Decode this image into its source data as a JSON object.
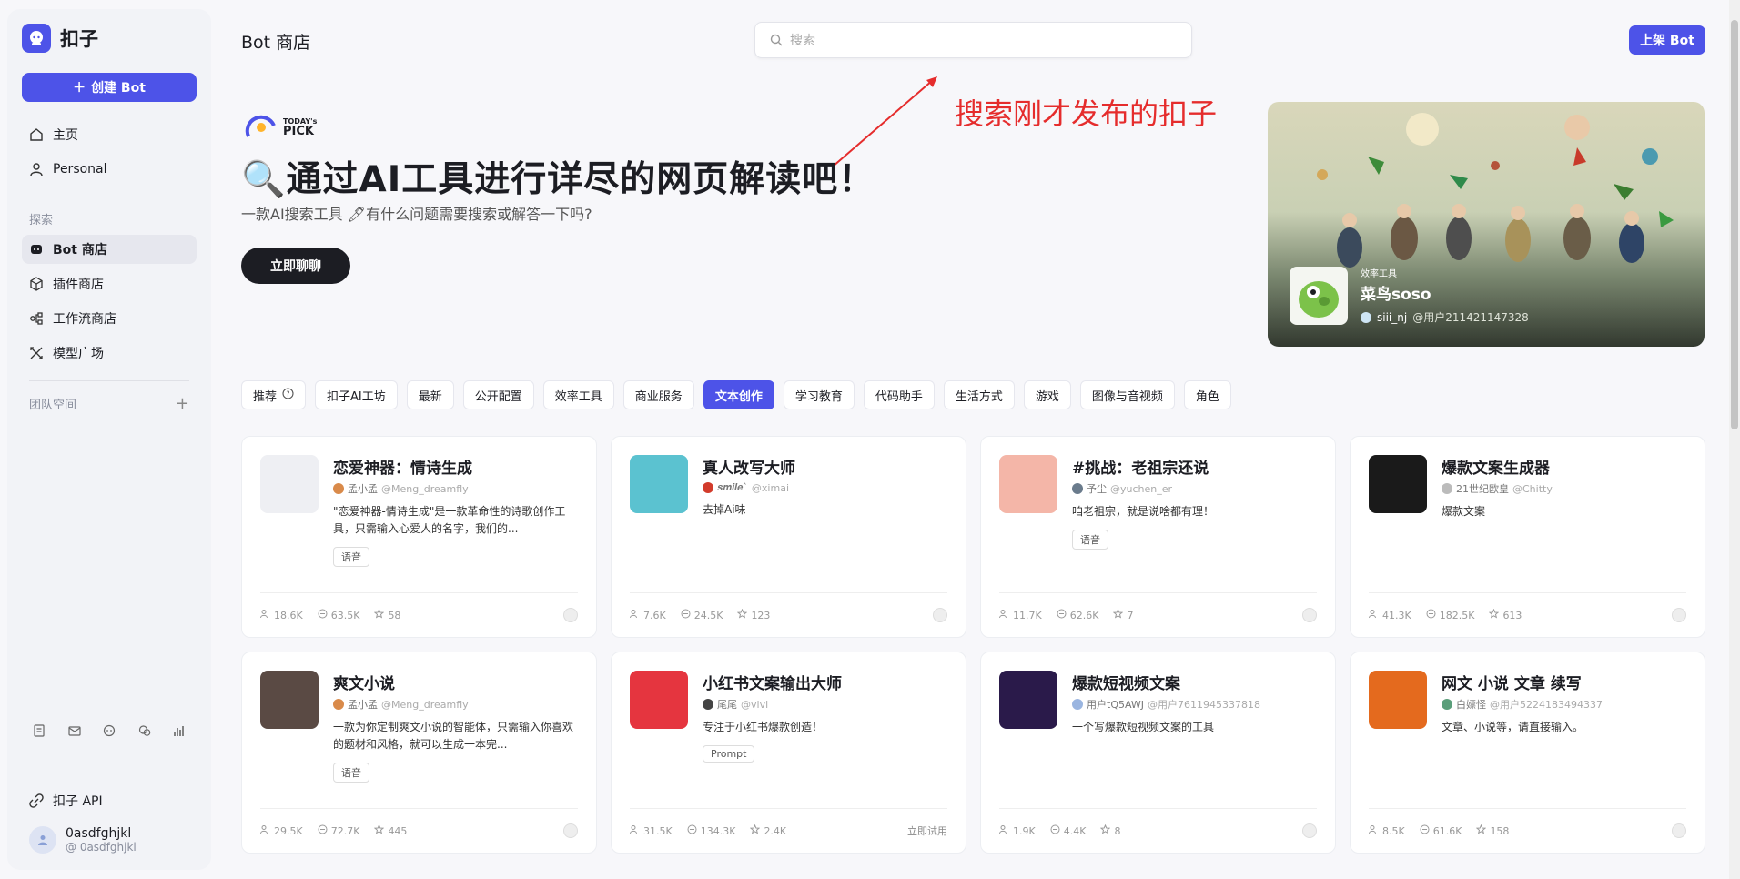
{
  "brand": {
    "name": "扣子"
  },
  "sidebar": {
    "create_label": "创建 Bot",
    "nav": [
      {
        "label": "主页",
        "icon": "home-icon"
      },
      {
        "label": "Personal",
        "icon": "person-icon"
      }
    ],
    "explore_label": "探索",
    "explore": [
      {
        "label": "Bot 商店",
        "icon": "bot-icon",
        "active": true
      },
      {
        "label": "插件商店",
        "icon": "cube-icon"
      },
      {
        "label": "工作流商店",
        "icon": "workflow-icon"
      },
      {
        "label": "模型广场",
        "icon": "model-icon"
      }
    ],
    "team_label": "团队空间",
    "api_label": "扣子 API",
    "user": {
      "name": "0asdfghjkl",
      "handle": "@ 0asdfghjkl"
    }
  },
  "header": {
    "title": "Bot 商店",
    "search_placeholder": "搜索",
    "upload_label": "上架 Bot"
  },
  "annotation": {
    "text": "搜索刚才发布的扣子",
    "color": "#e52c2c"
  },
  "hero": {
    "pick_top": "TODAY's",
    "pick_bottom": "PICK",
    "title": "🔍通过AI工具进行详尽的网页解读吧！",
    "subtitle": "一款AI搜索工具 🖊有什么问题需要搜索或解答一下吗?",
    "cta": "立即聊聊"
  },
  "banner": {
    "category": "效率工具",
    "name": "菜鸟soso",
    "author": "siii_nj",
    "handle": "@用户211421147328"
  },
  "tabs": [
    {
      "label": "推荐"
    },
    {
      "label": "扣子AI工坊"
    },
    {
      "label": "最新"
    },
    {
      "label": "公开配置"
    },
    {
      "label": "效率工具"
    },
    {
      "label": "商业服务"
    },
    {
      "label": "文本创作",
      "active": true
    },
    {
      "label": "学习教育"
    },
    {
      "label": "代码助手"
    },
    {
      "label": "生活方式"
    },
    {
      "label": "游戏"
    },
    {
      "label": "图像与音视频"
    },
    {
      "label": "角色"
    }
  ],
  "cards": [
    {
      "title": "恋爱神器：情诗生成",
      "author": "孟小孟",
      "handle": "@Meng_dreamfly",
      "desc": "\"恋爱神器-情诗生成\"是一款革命性的诗歌创作工具，只需输入心爱人的名字，我们的...",
      "tag": "语音",
      "users": "18.6K",
      "chats": "63.5K",
      "stars": "58",
      "img_color": "#eeeff3",
      "av_color": "#d98a4a"
    },
    {
      "title": "真人改写大师",
      "author": "𝒔𝒎𝒊𝒍𝒆`",
      "handle": "@ximai",
      "desc": "去掉Ai味",
      "tag": "",
      "users": "7.6K",
      "chats": "24.5K",
      "stars": "123",
      "img_color": "#5bc2d0",
      "av_color": "#d23b2b"
    },
    {
      "title": "#挑战：老祖宗还说",
      "author": "予尘",
      "handle": "@yuchen_er",
      "desc": "咱老祖宗，就是说啥都有理！",
      "tag": "语音",
      "users": "11.7K",
      "chats": "62.6K",
      "stars": "7",
      "img_color": "#f4b6a8",
      "av_color": "#6a7b8c"
    },
    {
      "title": "爆款文案生成器",
      "author": "21世纪欧皇",
      "handle": "@Chitty",
      "desc": "爆款文案",
      "tag": "",
      "users": "41.3K",
      "chats": "182.5K",
      "stars": "613",
      "img_color": "#1a1a1a",
      "av_color": "#bbbbbb"
    },
    {
      "title": "爽文小说",
      "author": "孟小孟",
      "handle": "@Meng_dreamfly",
      "desc": "一款为你定制爽文小说的智能体，只需输入你喜欢的题材和风格，就可以生成一本完...",
      "tag": "语音",
      "users": "29.5K",
      "chats": "72.7K",
      "stars": "445",
      "img_color": "#5a4a44",
      "av_color": "#d98a4a"
    },
    {
      "title": "小红书文案输出大师",
      "author": "尾尾",
      "handle": "@vivi",
      "desc": "专注于小红书爆款创造！",
      "tag": "Prompt",
      "users": "31.5K",
      "chats": "134.3K",
      "stars": "2.4K",
      "img_color": "#e5353f",
      "av_color": "#444444",
      "try": "立即试用"
    },
    {
      "title": "爆款短视频文案",
      "author": "用户tQ5AWJ",
      "handle": "@用户7611945337818",
      "desc": "一个写爆款短视频文案的工具",
      "tag": "",
      "users": "1.9K",
      "chats": "4.4K",
      "stars": "8",
      "img_color": "#2a1a4a",
      "av_color": "#9ab5e0"
    },
    {
      "title": "网文 小说 文章 续写",
      "author": "白嫖怪",
      "handle": "@用户5224183494337",
      "desc": "文章、小说等，请直接输入。",
      "tag": "",
      "users": "8.5K",
      "chats": "61.6K",
      "stars": "158",
      "img_color": "#e46a1e",
      "av_color": "#5a9e7a"
    }
  ]
}
